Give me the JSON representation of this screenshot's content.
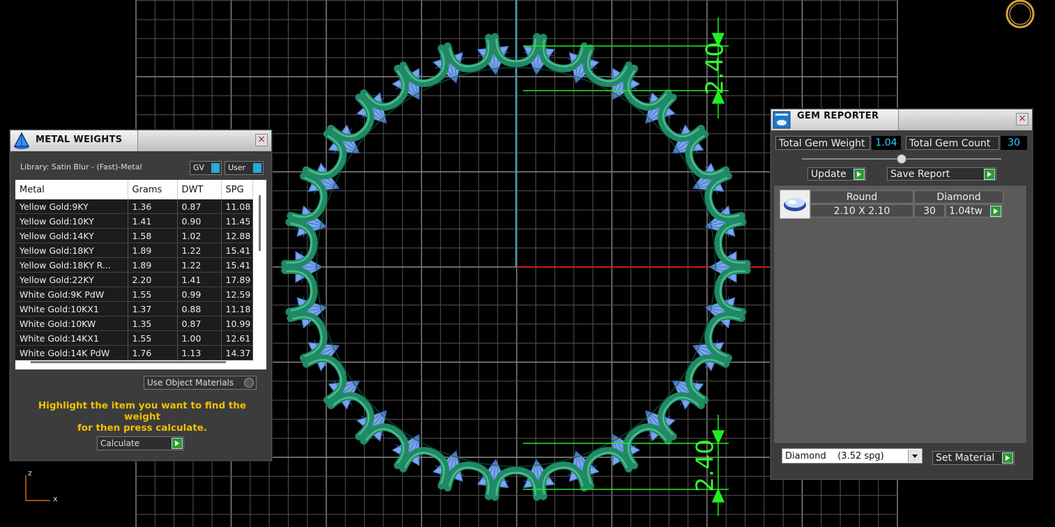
{
  "metal_weights": {
    "title": "METAL WEIGHTS",
    "close": "×",
    "library_label": "Library: Satin Blur - (Fast)-Metal",
    "gv_label": "GV",
    "user_label": "User",
    "columns": [
      "Metal",
      "Grams",
      "DWT",
      "SPG"
    ],
    "rows": [
      [
        "Yellow Gold:9KY",
        "1.36",
        "0.87",
        "11.08"
      ],
      [
        "Yellow Gold:10KY",
        "1.41",
        "0.90",
        "11.45"
      ],
      [
        "Yellow Gold:14KY",
        "1.58",
        "1.02",
        "12.88"
      ],
      [
        "Yellow Gold:18KY",
        "1.89",
        "1.22",
        "15.41"
      ],
      [
        "Yellow Gold:18KY R...",
        "1.89",
        "1.22",
        "15.41"
      ],
      [
        "Yellow Gold:22KY",
        "2.20",
        "1.41",
        "17.89"
      ],
      [
        "White Gold:9K PdW",
        "1.55",
        "0.99",
        "12.59"
      ],
      [
        "White Gold:10KX1",
        "1.37",
        "0.88",
        "11.18"
      ],
      [
        "White Gold:10KW",
        "1.35",
        "0.87",
        "10.99"
      ],
      [
        "White Gold:14KX1",
        "1.55",
        "1.00",
        "12.61"
      ],
      [
        "White Gold:14K PdW",
        "1.76",
        "1.13",
        "14.37"
      ]
    ],
    "use_object_materials": "Use Object Materials",
    "hint_line1": "Highlight the item you want to find the weight",
    "hint_line2": "for then press calculate.",
    "calculate_label": "Calculate"
  },
  "gem_reporter": {
    "title": "GEM REPORTER",
    "close": "×",
    "total_weight_label": "Total Gem Weight",
    "total_weight_value": "1.04",
    "total_count_label": "Total Gem Count",
    "total_count_value": "30",
    "update_label": "Update",
    "save_report_label": "Save Report",
    "gem_row": {
      "shape": "Round",
      "material": "Diamond",
      "size": "2.10 X 2.10",
      "count": "30",
      "weight": "1.04tw"
    },
    "material_select": "Diamond    (3.52 spg)",
    "set_material_label": "Set Material"
  },
  "viewport": {
    "dimension_top": "2.40",
    "dimension_bottom": "2.40",
    "axis_z": "z",
    "axis_x": "x",
    "colors": {
      "metal": "#1f8a63",
      "gem": "#7aa6ee",
      "grid": "#6a6a6a",
      "dim": "#22ee22",
      "x_axis": "#c41e1e",
      "y_axis": "#2aa8b8"
    },
    "gem_count": 30
  }
}
